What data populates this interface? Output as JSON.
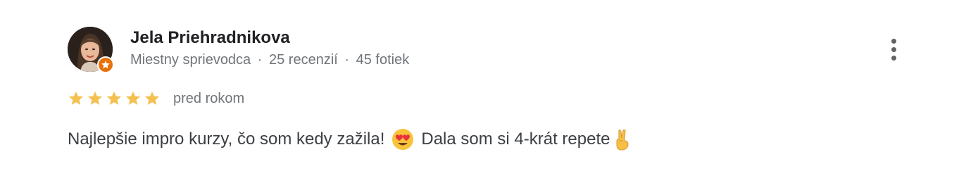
{
  "review": {
    "reviewer": {
      "name": "Jela Priehradnikova",
      "badge": "Miestny sprievodca",
      "reviews_count": "25 recenzií",
      "photos_count": "45 fotiek",
      "separator": "·",
      "avatar_icon": "user-photo",
      "badge_icon": "local-guide-star-icon",
      "badge_color": "#e8710a"
    },
    "rating": {
      "stars": 5,
      "max_stars": 5,
      "star_color": "#f4c04e"
    },
    "date": "pred rokom",
    "text_part1": "Najlepšie impro kurzy, čo som kedy zažila!",
    "text_part2": "Dala som si 4-krát repete",
    "emojis": [
      "smiling-face-with-heart-eyes",
      "victory-hand"
    ],
    "more_options_icon": "more-vert-icon"
  }
}
